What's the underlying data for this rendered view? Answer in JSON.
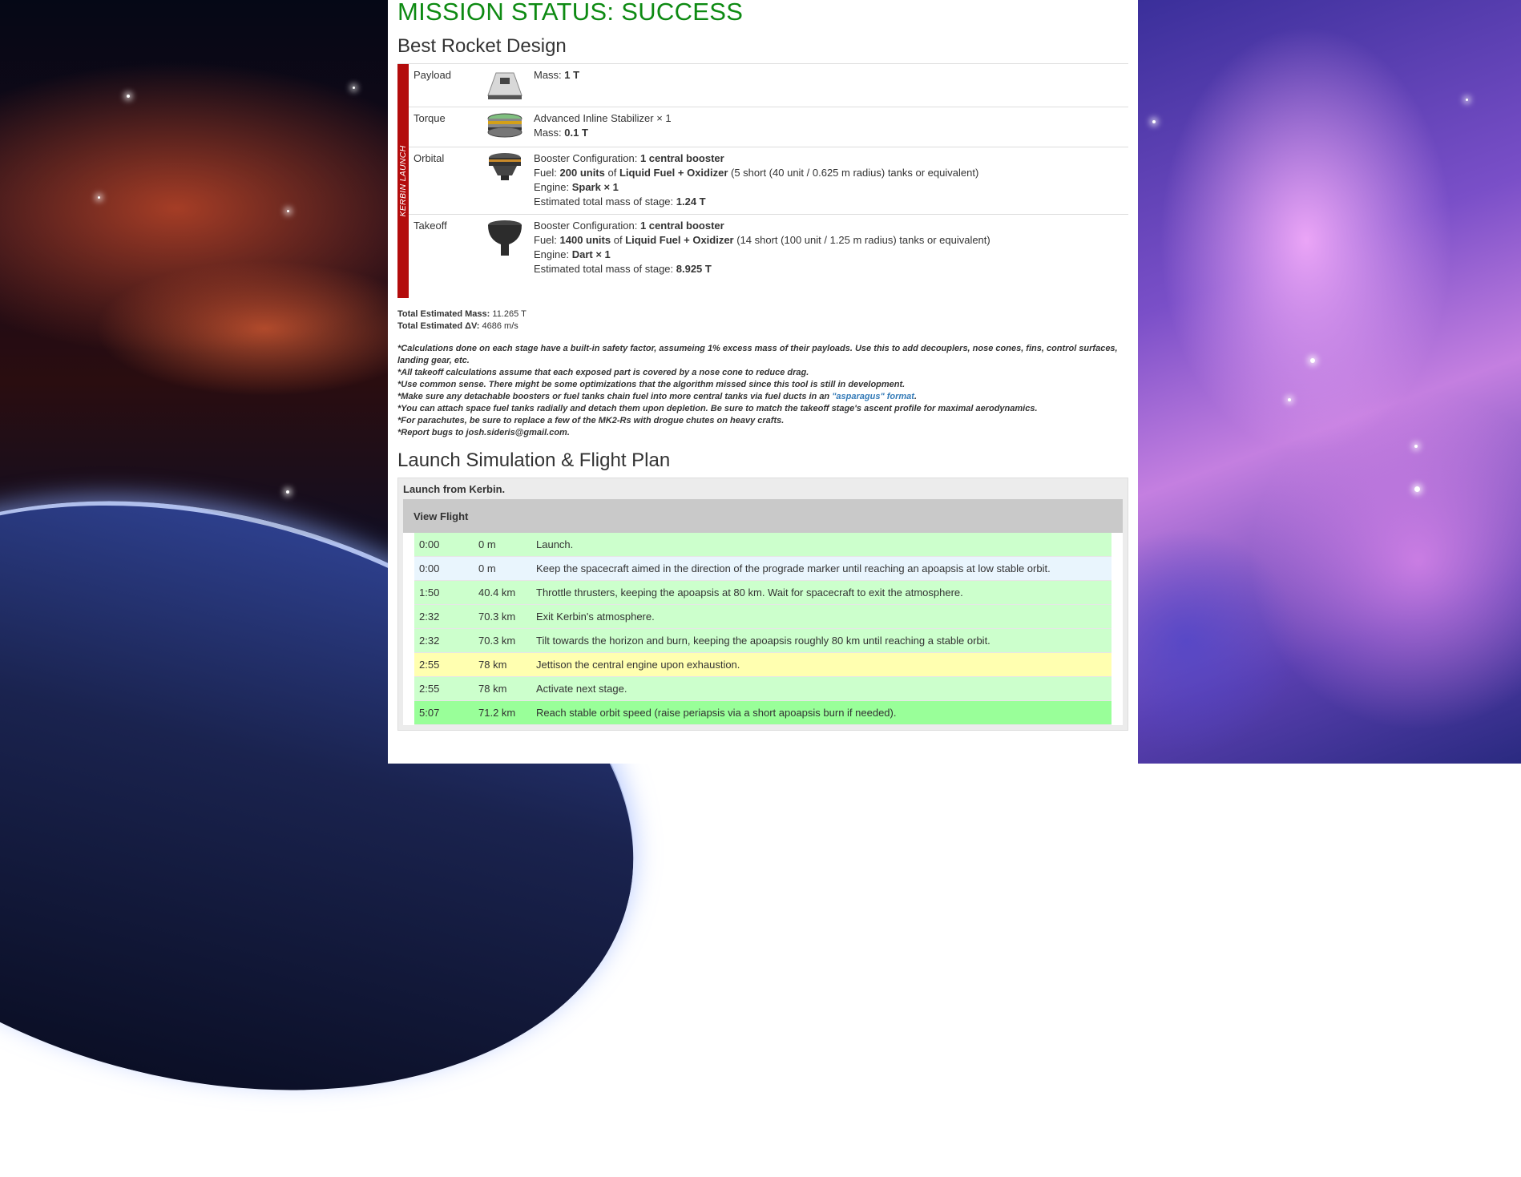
{
  "mission_status": "MISSION STATUS: SUCCESS",
  "design_heading": "Best Rocket Design",
  "launch_label": "KERBIN LAUNCH",
  "stages": [
    {
      "name": "Payload",
      "icon": "capsule-icon",
      "lines": [
        {
          "parts": [
            {
              "t": "Mass: ",
              "b": false
            },
            {
              "t": "1 T",
              "b": true
            }
          ]
        }
      ]
    },
    {
      "name": "Torque",
      "icon": "stabilizer-icon",
      "lines": [
        {
          "parts": [
            {
              "t": "Advanced Inline Stabilizer × 1",
              "b": false
            }
          ]
        },
        {
          "parts": [
            {
              "t": "Mass: ",
              "b": false
            },
            {
              "t": "0.1 T",
              "b": true
            }
          ]
        }
      ]
    },
    {
      "name": "Orbital",
      "icon": "spark-engine-icon",
      "lines": [
        {
          "parts": [
            {
              "t": "Booster Configuration: ",
              "b": false
            },
            {
              "t": "1 central booster",
              "b": true
            }
          ]
        },
        {
          "parts": [
            {
              "t": "Fuel: ",
              "b": false
            },
            {
              "t": "200 units",
              "b": true
            },
            {
              "t": " of ",
              "b": false
            },
            {
              "t": "Liquid Fuel + Oxidizer",
              "b": true
            },
            {
              "t": " (5 short (40 unit / 0.625 m radius) tanks or equivalent)",
              "b": false
            }
          ]
        },
        {
          "parts": [
            {
              "t": "Engine: ",
              "b": false
            },
            {
              "t": "Spark × 1",
              "b": true
            }
          ]
        },
        {
          "parts": [
            {
              "t": "Estimated total mass of stage: ",
              "b": false
            },
            {
              "t": "1.24 T",
              "b": true
            }
          ]
        }
      ]
    },
    {
      "name": "Takeoff",
      "icon": "dart-engine-icon",
      "lines": [
        {
          "parts": [
            {
              "t": "Booster Configuration: ",
              "b": false
            },
            {
              "t": "1 central booster",
              "b": true
            }
          ]
        },
        {
          "parts": [
            {
              "t": "Fuel: ",
              "b": false
            },
            {
              "t": "1400 units",
              "b": true
            },
            {
              "t": " of ",
              "b": false
            },
            {
              "t": "Liquid Fuel + Oxidizer",
              "b": true
            },
            {
              "t": " (14 short (100 unit / 1.25 m radius) tanks or equivalent)",
              "b": false
            }
          ]
        },
        {
          "parts": [
            {
              "t": "Engine: ",
              "b": false
            },
            {
              "t": "Dart × 1",
              "b": true
            }
          ]
        },
        {
          "parts": [
            {
              "t": "Estimated total mass of stage: ",
              "b": false
            },
            {
              "t": "8.925 T",
              "b": true
            }
          ]
        }
      ]
    }
  ],
  "totals": {
    "mass_label": "Total Estimated Mass:",
    "mass_value": "11.265 T",
    "dv_label": "Total Estimated ΔV:",
    "dv_value": "4686 m/s"
  },
  "notes": [
    "*Calculations done on each stage have a built-in safety factor, assumeing 1% excess mass of their payloads. Use this to add decouplers, nose cones, fins, control surfaces, landing gear, etc.",
    "*All takeoff calculations assume that each exposed part is covered by a nose cone to reduce drag.",
    "*Use common sense. There might be some optimizations that the algorithm missed since this tool is still in development.",
    "*You can attach space fuel tanks radially and detach them upon depletion. Be sure to match the takeoff stage's ascent profile for maximal aerodynamics.",
    "*For parachutes, be sure to replace a few of the MK2-Rs with drogue chutes on heavy crafts.",
    "*Report bugs to josh.sideris@gmail.com."
  ],
  "note_asparagus": {
    "before": "*Make sure any detachable boosters or fuel tanks chain fuel into more central tanks via fuel ducts in an ",
    "link": "\"asparagus\" format",
    "after": "."
  },
  "flight_heading": "Launch Simulation & Flight Plan",
  "flight_panel_title": "Launch from Kerbin.",
  "view_flight_label": "View Flight",
  "flight_rows": [
    {
      "time": "0:00",
      "alt": "0 m",
      "desc": "Launch.",
      "color": "#ccffcc"
    },
    {
      "time": "0:00",
      "alt": "0 m",
      "desc": "Keep the spacecraft aimed in the direction of the prograde marker until reaching an apoapsis at low stable orbit.",
      "color": "#e9f5fd"
    },
    {
      "time": "1:50",
      "alt": "40.4 km",
      "desc": "Throttle thrusters, keeping the apoapsis at 80 km. Wait for spacecraft to exit the atmosphere.",
      "color": "#ccffcc"
    },
    {
      "time": "2:32",
      "alt": "70.3 km",
      "desc": "Exit Kerbin's atmosphere.",
      "color": "#ccffcc"
    },
    {
      "time": "2:32",
      "alt": "70.3 km",
      "desc": "Tilt towards the horizon and burn, keeping the apoapsis roughly 80 km until reaching a stable orbit.",
      "color": "#ccffcc"
    },
    {
      "time": "2:55",
      "alt": "78 km",
      "desc": "Jettison the central engine upon exhaustion.",
      "color": "#ffffb0"
    },
    {
      "time": "2:55",
      "alt": "78 km",
      "desc": "Activate next stage.",
      "color": "#ccffcc"
    },
    {
      "time": "5:07",
      "alt": "71.2 km",
      "desc": "Reach stable orbit speed (raise periapsis via a short apoapsis burn if needed).",
      "color": "#99ff99"
    }
  ],
  "colors": {
    "success_green": "#0d8a12",
    "launch_red": "#b30c0c",
    "link_blue": "#337ab7"
  }
}
